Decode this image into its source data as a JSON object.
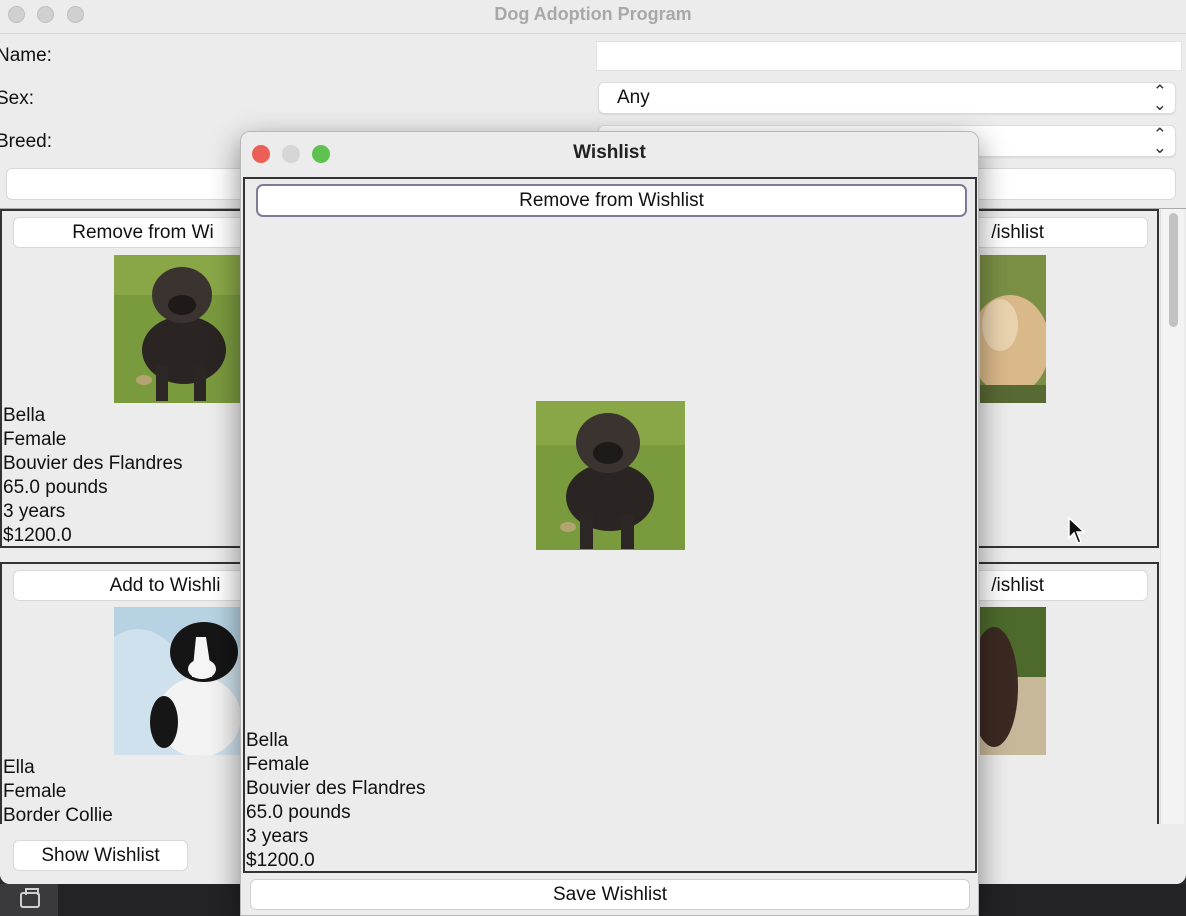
{
  "app": {
    "title": "Dog Adoption Program",
    "form": {
      "name_label": "Name:",
      "name_value": "",
      "sex_label": "Sex:",
      "sex_value": "Any",
      "breed_label": "Breed:",
      "breed_value": ""
    },
    "cards": [
      {
        "button": "Remove from Wi",
        "lines": [
          "Bella",
          "Female",
          "Bouvier des Flandres",
          "65.0 pounds",
          "3 years",
          "$1200.0"
        ]
      },
      {
        "button": "/ishlist",
        "lines": []
      },
      {
        "button": "Add to Wishli",
        "lines": [
          "Ella",
          "Female",
          "Border Collie"
        ]
      },
      {
        "button": "/ishlist",
        "lines": []
      }
    ],
    "show_wishlist_label": "Show Wishlist"
  },
  "wishlist": {
    "title": "Wishlist",
    "remove_label": "Remove from Wishlist",
    "item_lines": [
      "Bella",
      "Female",
      "Bouvier des Flandres",
      "65.0 pounds",
      "3 years",
      "$1200.0"
    ],
    "save_label": "Save Wishlist"
  },
  "colors": {
    "close": "#ec5f56",
    "minimize": "#d6d6d6",
    "zoom": "#5fc250",
    "window_bg": "#ececec"
  },
  "icons": {
    "select_arrows": "⌃⌄",
    "dock_item": "printer-icon"
  }
}
